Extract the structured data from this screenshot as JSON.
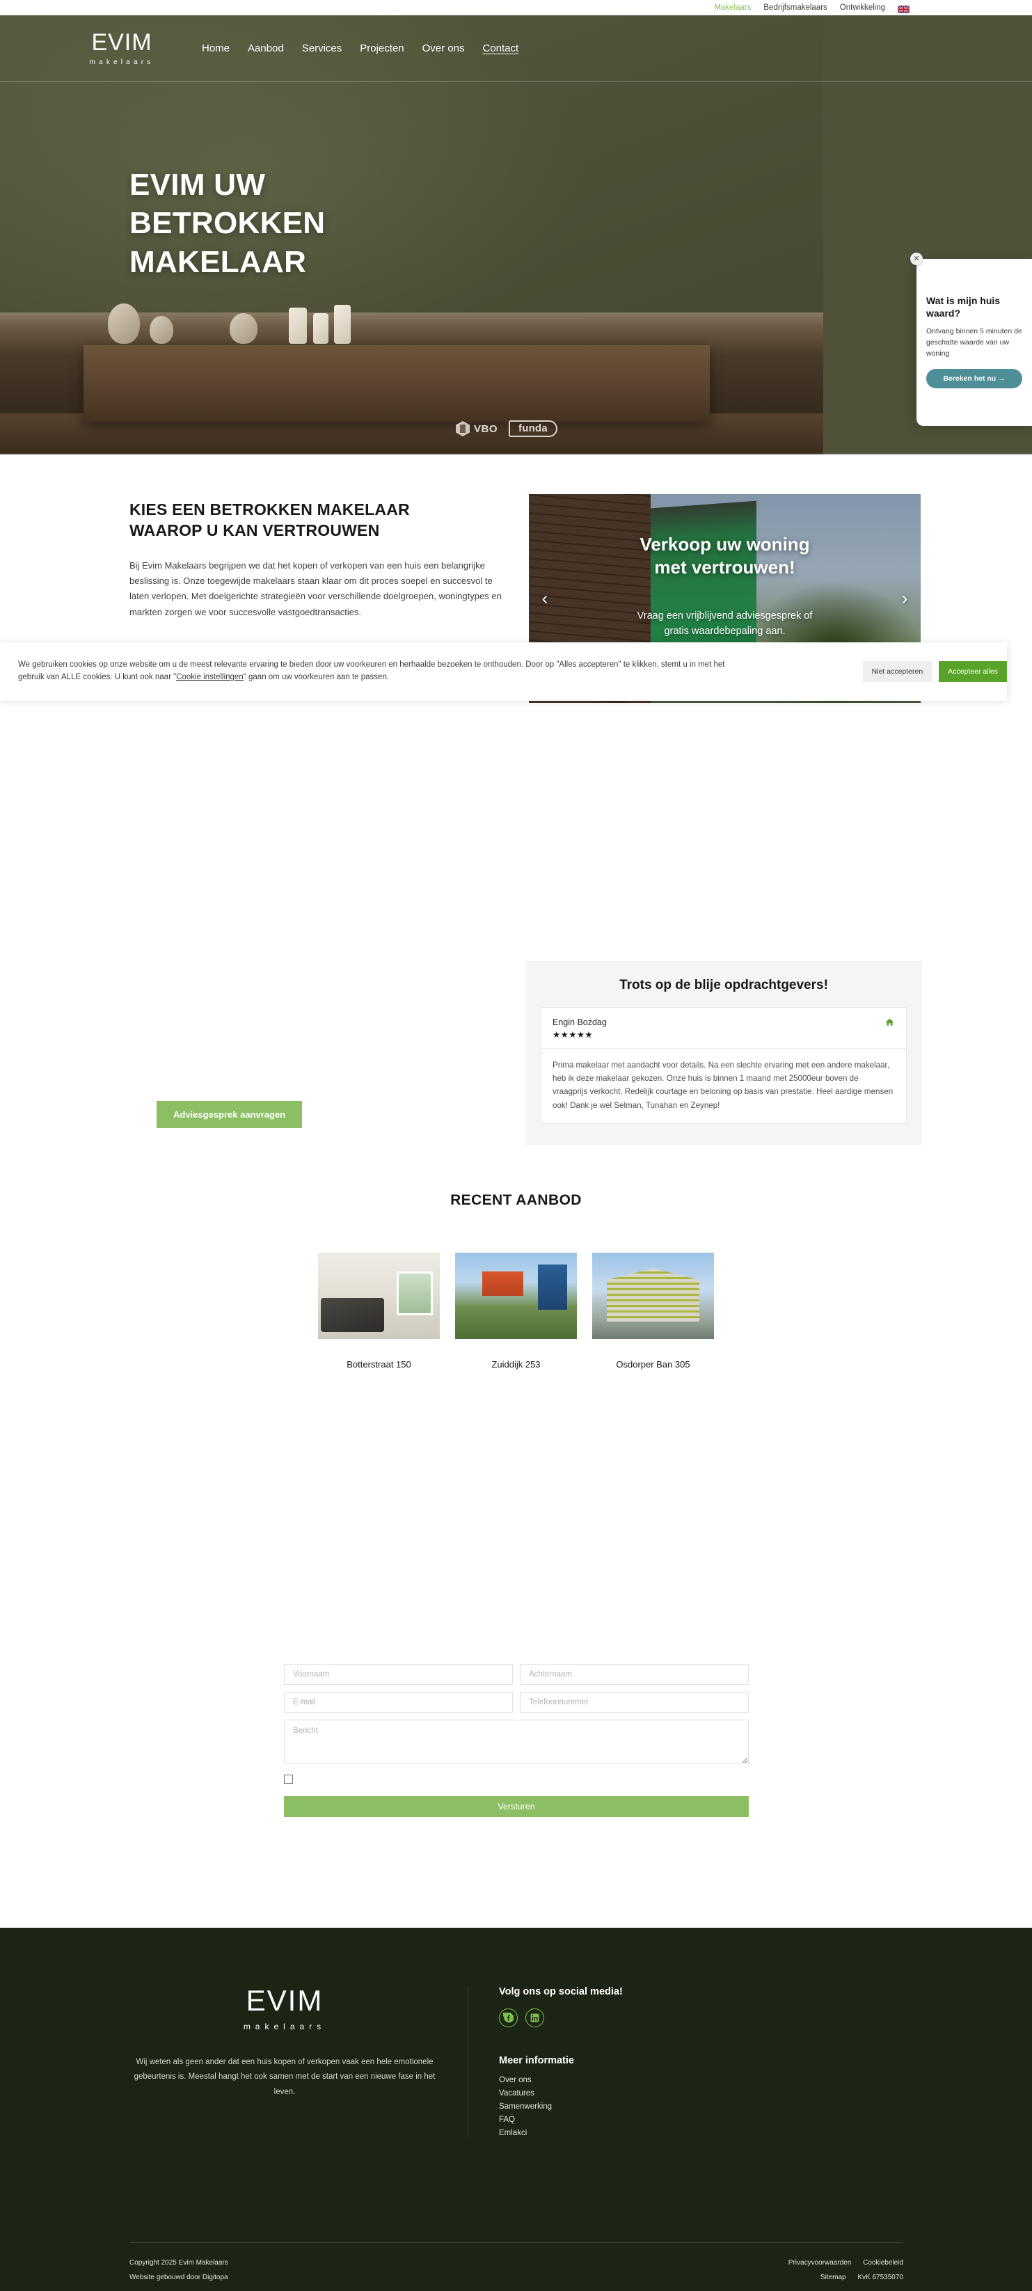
{
  "utility_nav": {
    "items": [
      {
        "label": "Makelaars",
        "active": true
      },
      {
        "label": "Bedrijfsmakelaars",
        "active": false
      },
      {
        "label": "Ontwikkeling",
        "active": false
      }
    ],
    "flag": "uk-flag-icon"
  },
  "brand": {
    "name": "EVIM",
    "tagline": "makelaars"
  },
  "main_nav": {
    "items": [
      {
        "label": "Home",
        "underlined": false
      },
      {
        "label": "Aanbod",
        "underlined": false
      },
      {
        "label": "Services",
        "underlined": false
      },
      {
        "label": "Projecten",
        "underlined": false
      },
      {
        "label": "Over ons",
        "underlined": false
      },
      {
        "label": "Contact",
        "underlined": true
      }
    ]
  },
  "hero": {
    "title_line1": "EVIM UW",
    "title_line2": "BETROKKEN",
    "title_line3": "MAKELAAR",
    "badges": [
      {
        "label": "VBO",
        "icon": "vbo-logo-icon"
      },
      {
        "label": "funda",
        "icon": "funda-logo-icon"
      }
    ]
  },
  "value_popup": {
    "close_icon": "close-icon",
    "title": "Wat is mijn huis waard?",
    "text": "Ontvang binnen 5 minuten de geschatte waarde van uw woning",
    "button": "Bereken het nu →",
    "accent_color": "#4e8e97"
  },
  "intro": {
    "heading_line1": "KIES EEN BETROKKEN MAKELAAR",
    "heading_line2": "WAAROP U KAN VERTROUWEN",
    "paragraph": "Bij Evim Makelaars begrijpen we dat het kopen of verkopen van een huis een belangrijke beslissing is. Onze toegewijde makelaars staan klaar om dit proces soepel en succesvol te laten verlopen. Met doelgerichte strategieën voor verschillende doelgroepen, woningtypes en markten zorgen we voor succesvolle vastgoedtransacties."
  },
  "slider": {
    "title_line1": "Verkoop uw woning",
    "title_line2": "met vertrouwen!",
    "subtitle_line1": "Vraag een vrijblijvend adviesgesprek of",
    "subtitle_line2": "gratis waardebepaling aan.",
    "prev_icon": "chevron-left-icon",
    "next_icon": "chevron-right-icon"
  },
  "cookie_banner": {
    "text_part1": "We gebruiken cookies op onze website om u de meest relevante ervaring te bieden door uw voorkeuren en herhaalde bezoeken te onthouden. Door op \"Alles accepteren\" te klikken, stemt u in met het gebruik van ALLE cookies. U kunt ook naar \"",
    "link_label": "Cookie instellingen",
    "text_part2": "\" gaan om uw voorkeuren aan te passen.",
    "decline_label": "Niet accepteren",
    "accept_label": "Accepteer alles",
    "accept_color": "#5aa32a"
  },
  "testimonials": {
    "title": "Trots op de blije opdrachtgevers!",
    "review": {
      "name": "Engin Bozdag",
      "stars": "★★★★★",
      "rating": 5,
      "source_icon": "house-icon",
      "body": "Prima makelaar met aandacht voor details. Na een slechte ervaring met een andere makelaar, heb ik deze makelaar gekozen. Onze huis is binnen 1 maand met 25000eur boven de vraagprijs verkocht. Redelijk courtage en beloning op basis van prestatie. Heel aardige mensen ook! Dank je wel Selman, Tunahan en Zeynep!"
    }
  },
  "cta": {
    "advies_label": "Adviesgesprek aanvragen",
    "color": "#8cbf63"
  },
  "recent": {
    "title": "RECENT AANBOD",
    "listings": [
      {
        "label": "Botterstraat 150",
        "image": "livingroom-photo"
      },
      {
        "label": "Zuiddijk 253",
        "image": "house-photo"
      },
      {
        "label": "Osdorper Ban 305",
        "image": "apartment-building-photo"
      }
    ]
  },
  "contact_form": {
    "firstname_placeholder": "Voornaam",
    "lastname_placeholder": "Achternaam",
    "email_placeholder": "E-mail",
    "phone_placeholder": "Telefoonnummer",
    "message_placeholder": "Bericht",
    "firstname_value": "",
    "lastname_value": "",
    "email_value": "",
    "phone_value": "",
    "message_value": "",
    "consent_checked": false,
    "submit_label": "Versturen"
  },
  "footer": {
    "logo_name": "EVIM",
    "logo_sub": "makelaars",
    "blurb": "Wij weten als geen ander dat een huis kopen of verkopen vaak een hele emotionele gebeurtenis is. Meestal hangt het ook samen met de start van een nieuwe fase in het leven.",
    "social_heading": "Volg ons op social media!",
    "socials": [
      {
        "name": "facebook-icon"
      },
      {
        "name": "linkedin-icon"
      }
    ],
    "info_heading": "Meer informatie",
    "info_links": [
      {
        "label": "Over ons"
      },
      {
        "label": "Vacatures"
      },
      {
        "label": "Samenwerking"
      },
      {
        "label": "FAQ"
      },
      {
        "label": "Emlakci"
      }
    ],
    "copyright": "Copyright 2025 Evim Makelaars",
    "built_by": "Website gebouwd door Digitopa",
    "legal": {
      "privacy": "Privacyvoorwaarden",
      "cookie": "Cookiebeleid",
      "sitemap": "Sitemap",
      "kvk": "KvK 67535070"
    },
    "background_color": "#1b2415",
    "accent_color": "#7cc24a"
  }
}
